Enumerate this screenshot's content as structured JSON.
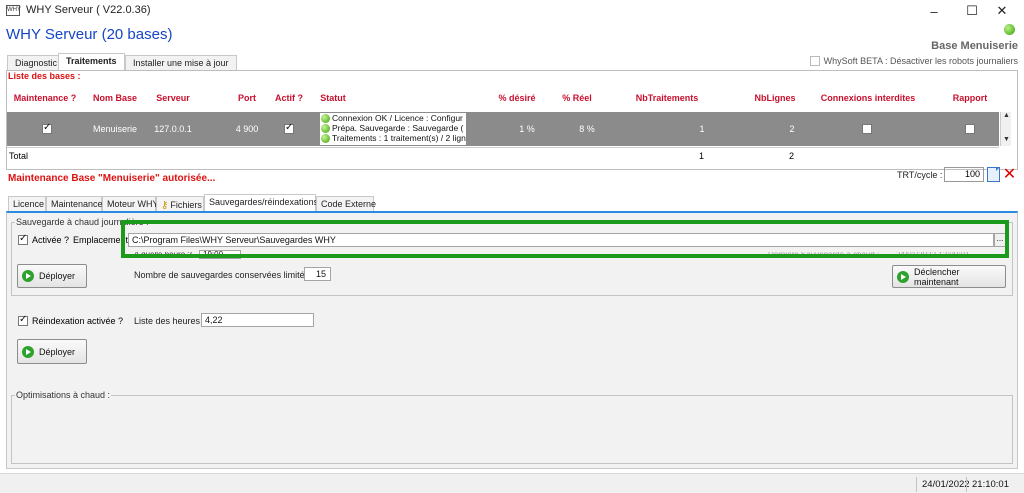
{
  "window": {
    "title": "WHY Serveur ( V22.0.36)",
    "icon_text": "WHY",
    "minimize": "–",
    "maximize": "☐",
    "close": "✕"
  },
  "header": {
    "title": "WHY Serveur (20 bases)",
    "base_label": "Base Menuiserie",
    "beta_label": "WhySoft BETA : Désactiver les robots journaliers"
  },
  "top_tabs": [
    {
      "label": "Diagnostic"
    },
    {
      "label": "Traitements"
    },
    {
      "label": "Installer une mise à jour"
    }
  ],
  "bases": {
    "title": "Liste des bases :",
    "columns": {
      "maintenance": "Maintenance ?",
      "nom_base": "Nom Base",
      "serveur": "Serveur",
      "port": "Port",
      "actif": "Actif ?",
      "statut": "Statut",
      "pct_desire": "% désiré",
      "pct_reel": "% Réel",
      "nb_traitements": "NbTraitements",
      "nb_lignes": "NbLignes",
      "connexions": "Connexions interdites",
      "rapport": "Rapport"
    },
    "row": {
      "nom_base": "Menuiserie",
      "serveur": "127.0.0.1",
      "port": "4 900",
      "statut": [
        "Connexion OK / Licence : Configur",
        "Prépa. Sauvegarde : Sauvegarde (",
        "Traitements : 1 traitement(s) / 2 lign"
      ],
      "pct_desire": "1 %",
      "pct_reel": "8 %",
      "nb_traitements": "1",
      "nb_lignes": "2"
    },
    "total": {
      "label": "Total",
      "nb_traitements": "1",
      "nb_lignes": "2"
    }
  },
  "maintenance_message": "Maintenance Base \"Menuiserie\" autorisée...",
  "trt": {
    "label": "TRT/cycle :",
    "value": "100"
  },
  "sub_tabs": [
    {
      "label": "Licence"
    },
    {
      "label": "Maintenance"
    },
    {
      "label": "Moteur WHY"
    },
    {
      "label": "Fichiers"
    },
    {
      "label": "Sauvegardes/réindexations"
    },
    {
      "label": "Code Externe"
    }
  ],
  "backup": {
    "legend": "Sauvegarde à chaud journalière :",
    "activated_label": "Activée ?",
    "location_label": "Emplacement",
    "path": "C:\\Program Files\\WHY Serveur\\Sauvegardes WHY",
    "browse": "...",
    "time_label": "A quelle heure ?",
    "time_value": "19:00",
    "last_label": "Dernière Sauvegarde à chaud :",
    "last_value": "24/01/2022 12:00:01",
    "deploy": "Déployer",
    "count_label": "Nombre de sauvegardes conservées limité à :",
    "count_value": "15",
    "trigger": "Déclencher maintenant"
  },
  "reindex": {
    "activated_label": "Réindexation activée ?",
    "hours_label": "Liste des heures ?",
    "hours_value": "4,22",
    "deploy": "Déployer"
  },
  "optim": {
    "legend": "Optimisations à chaud :"
  },
  "statusbar": {
    "date": "24/01/2022",
    "time": "21:10:01"
  },
  "colors": {
    "accent": "#1545c8",
    "highlight": "#1c9a1c",
    "alert": "#d11111"
  }
}
